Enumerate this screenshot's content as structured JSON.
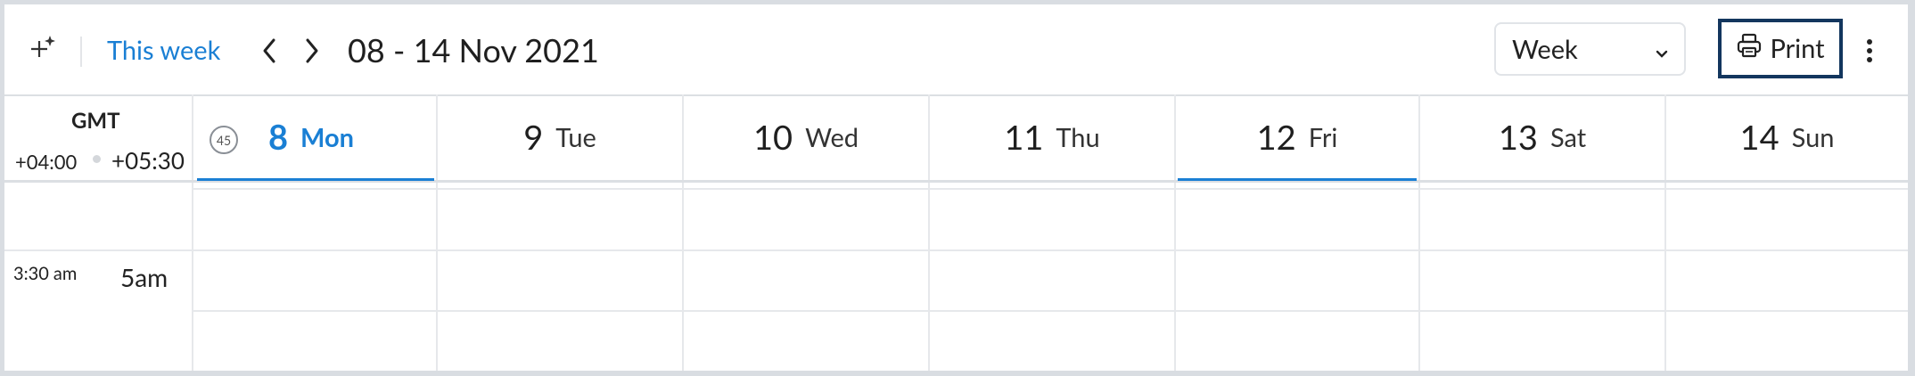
{
  "toolbar": {
    "this_week_label": "This week",
    "date_range": "08 - 14 Nov 2021",
    "view_select_value": "Week",
    "print_label": "Print"
  },
  "timezone": {
    "label": "GMT",
    "primary_offset": "+04:00",
    "secondary_offset": "+05:30"
  },
  "week_number": "45",
  "days": [
    {
      "num": "8",
      "name": "Mon"
    },
    {
      "num": "9",
      "name": "Tue"
    },
    {
      "num": "10",
      "name": "Wed"
    },
    {
      "num": "11",
      "name": "Thu"
    },
    {
      "num": "12",
      "name": "Fri"
    },
    {
      "num": "13",
      "name": "Sat"
    },
    {
      "num": "14",
      "name": "Sun"
    }
  ],
  "time_labels": {
    "primary": "3:30 am",
    "secondary": "5am"
  },
  "colors": {
    "accent": "#1a7fd4",
    "print_border": "#13365e"
  },
  "icons": [
    "magic-wand-icon",
    "chevron-left-icon",
    "chevron-right-icon",
    "chevron-down-icon",
    "printer-icon",
    "more-vertical-icon"
  ]
}
